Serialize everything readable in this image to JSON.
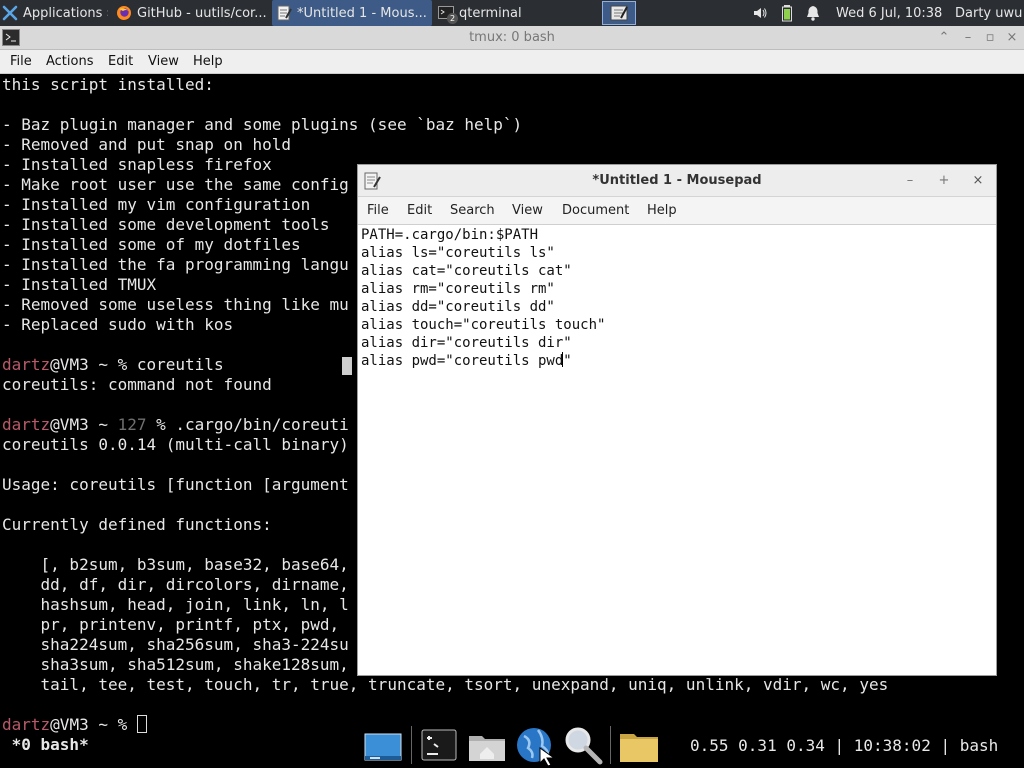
{
  "panel": {
    "applications_label": "Applications",
    "tasks": [
      {
        "label": "GitHub - uutils/cor..."
      },
      {
        "label": "*Untitled 1 - Mous..."
      },
      {
        "label": "qterminal"
      }
    ],
    "badge": "2",
    "clock": "Wed  6 Jul, 10:38",
    "user": "Darty uwu"
  },
  "qterminal": {
    "title": "tmux: 0 bash",
    "menu": [
      "File",
      "Actions",
      "Edit",
      "View",
      "Help"
    ],
    "lines": [
      "this script installed:",
      "",
      "- Baz plugin manager and some plugins (see `baz help`)",
      "- Removed and put snap on hold",
      "- Installed snapless firefox",
      "- Make root user use the same config",
      "- Installed my vim configuration",
      "- Installed some development tools",
      "- Installed some of my dotfiles",
      "- Installed the fa programming langu",
      "- Installed TMUX",
      "- Removed some useless thing like mu",
      "- Replaced sudo with kos"
    ],
    "prompt_user": "dartz",
    "prompt_host": "@VM3 ~ ",
    "prompt_sign": "% ",
    "cmd1": "coreutils",
    "out1": "coreutils: command not found",
    "exit_code": "127 ",
    "cmd2": ".cargo/bin/coreuti",
    "out2": [
      "coreutils 0.0.14 (multi-call binary)",
      "",
      "Usage: coreutils [function [argument",
      "",
      "Currently defined functions:",
      "",
      "    [, b2sum, b3sum, base32, base64,",
      "    dd, df, dir, dircolors, dirname,",
      "    hashsum, head, join, link, ln, l",
      "    pr, printenv, printf, ptx, pwd, ",
      "    sha224sum, sha256sum, sha3-224su",
      "    sha3sum, sha512sum, shake128sum,",
      "    tail, tee, test, touch, tr, true, truncate, tsort, unexpand, uniq, unlink, vdir, wc, yes"
    ],
    "tmux_window": " *0 bash*",
    "tmux_status_right": "0.55 0.31 0.34 | 10:38:02 | bash"
  },
  "mousepad": {
    "title": "*Untitled 1 - Mousepad",
    "menu": [
      "File",
      "Edit",
      "Search",
      "View",
      "Document",
      "Help"
    ],
    "lines": [
      "PATH=.cargo/bin:$PATH",
      "alias ls=\"coreutils ls\"",
      "alias cat=\"coreutils cat\"",
      "alias rm=\"coreutils rm\"",
      "alias dd=\"coreutils dd\"",
      "alias touch=\"coreutils touch\"",
      "alias dir=\"coreutils dir\""
    ],
    "last_line_before_caret": "alias pwd=\"coreutils pwd",
    "last_line_after_caret": "\""
  },
  "icons": {
    "panel": [
      "xfce-logo-icon",
      "firefox-icon",
      "text-editor-icon",
      "terminal-icon",
      "volume-icon",
      "battery-icon",
      "bell-icon"
    ],
    "dock": [
      "desktop-icon",
      "terminal-icon",
      "home-folder-icon",
      "web-browser-icon",
      "search-icon",
      "folder-icon"
    ]
  },
  "colors": {
    "panel_bg": "#2b2e33",
    "active_task": "#3d5b86",
    "prompt_user": "#b85a6a",
    "exit_code": "#6f6f6f"
  }
}
